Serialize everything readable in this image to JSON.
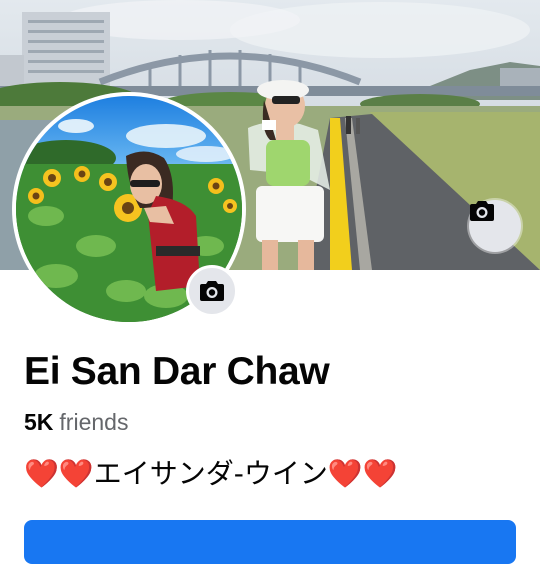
{
  "profile": {
    "name": "Ei San Dar Chaw",
    "friends_count": "5K",
    "friends_label": "friends",
    "bio": {
      "prefix_icon": "❤️❤️",
      "text": "エイサンダ-ウイン",
      "suffix_icon": "❤️❤️"
    },
    "primary_button_label": ""
  },
  "icons": {
    "cover_edit": "camera-icon",
    "avatar_edit": "camera-icon"
  },
  "colors": {
    "primary": "#1877f2",
    "icon_button_bg": "#e4e6eb",
    "secondary_text": "#65676b",
    "heart": "#e0245e"
  }
}
